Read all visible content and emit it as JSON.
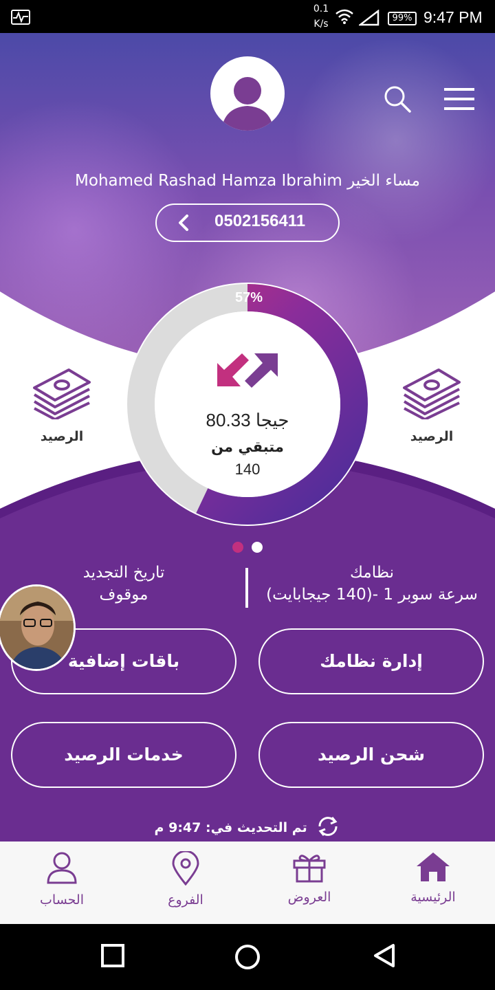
{
  "status_bar": {
    "net_speed_value": "0.1",
    "net_speed_unit": "K/s",
    "battery": "99%",
    "time": "9:47 PM"
  },
  "header": {
    "greeting": "Mohamed Rashad Hamza Ibrahim مساء الخير",
    "phone_number": "0502156411",
    "icons": [
      "profile-avatar-icon",
      "search-icon",
      "menu-icon"
    ]
  },
  "usage": {
    "percent_label": "57%",
    "used_fraction": 0.57,
    "amount": "80.33 جيجا",
    "remaining_label": "متبقي من",
    "total": "140"
  },
  "balance_tiles": {
    "left_label": "الرصيد",
    "right_label": "الرصيد"
  },
  "plan": {
    "plan_header": "نظامك",
    "plan_value": "سرعة سوبر 1 -(140 جيجابايت)",
    "renew_header": "تاريخ التجديد",
    "renew_value": "موقوف"
  },
  "actions": {
    "manage_plan": "إدارة نظامك",
    "extra_packages": "باقات إضافية",
    "recharge": "شحن الرصيد",
    "balance_services": "خدمات الرصيد"
  },
  "updated": {
    "text": "تم التحديث في: 9:47 م"
  },
  "bottom_nav": {
    "home": "الرئيسية",
    "offers": "العروض",
    "branches": "الفروع",
    "account": "الحساب"
  },
  "colors": {
    "brand_purple": "#6a2d90",
    "accent_magenta": "#c2307f",
    "nav_label": "#7a3d92"
  }
}
